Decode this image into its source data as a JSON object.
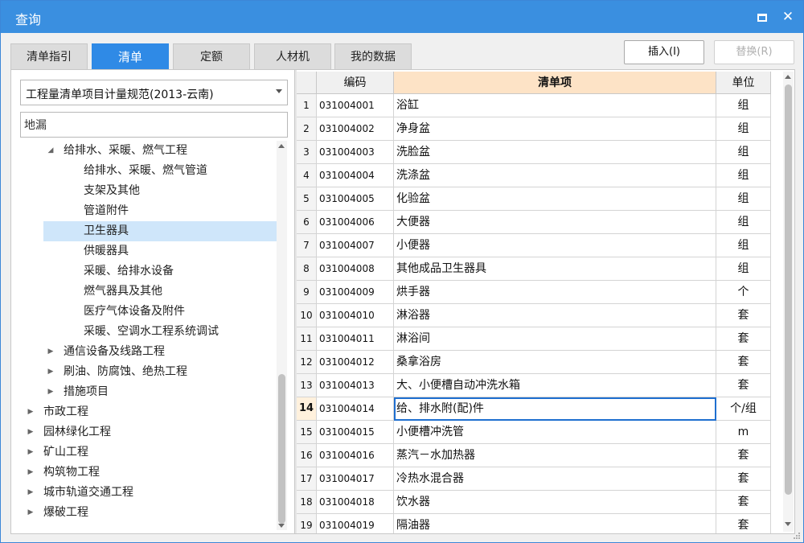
{
  "window": {
    "title": "查询",
    "maximize_icon": "maximize-icon",
    "close_icon": "close-icon",
    "close_glyph": "✕"
  },
  "tabs": [
    {
      "label": "清单指引",
      "active": false
    },
    {
      "label": "清单",
      "active": true
    },
    {
      "label": "定额",
      "active": false
    },
    {
      "label": "人材机",
      "active": false
    },
    {
      "label": "我的数据",
      "active": false
    }
  ],
  "actions": {
    "insert_label": "插入(I)",
    "replace_label": "替换(R)"
  },
  "left": {
    "spec_select": "工程量清单项目计量规范(2013-云南)",
    "filter_value": "地漏",
    "tree": [
      {
        "label": "给排水、采暖、燃气工程",
        "arrow": "◢",
        "level": 2,
        "selected": false
      },
      {
        "label": "给排水、采暖、燃气管道",
        "arrow": "",
        "level": 3,
        "selected": false
      },
      {
        "label": "支架及其他",
        "arrow": "",
        "level": 3,
        "selected": false
      },
      {
        "label": "管道附件",
        "arrow": "",
        "level": 3,
        "selected": false
      },
      {
        "label": "卫生器具",
        "arrow": "",
        "level": 3,
        "selected": true
      },
      {
        "label": "供暖器具",
        "arrow": "",
        "level": 3,
        "selected": false
      },
      {
        "label": "采暖、给排水设备",
        "arrow": "",
        "level": 3,
        "selected": false
      },
      {
        "label": "燃气器具及其他",
        "arrow": "",
        "level": 3,
        "selected": false
      },
      {
        "label": "医疗气体设备及附件",
        "arrow": "",
        "level": 3,
        "selected": false
      },
      {
        "label": "采暖、空调水工程系统调试",
        "arrow": "",
        "level": 3,
        "selected": false
      },
      {
        "label": "通信设备及线路工程",
        "arrow": "▶",
        "level": 2,
        "selected": false
      },
      {
        "label": "刷油、防腐蚀、绝热工程",
        "arrow": "▶",
        "level": 2,
        "selected": false
      },
      {
        "label": "措施项目",
        "arrow": "▶",
        "level": 2,
        "selected": false
      },
      {
        "label": "市政工程",
        "arrow": "▶",
        "level": 1,
        "selected": false
      },
      {
        "label": "园林绿化工程",
        "arrow": "▶",
        "level": 1,
        "selected": false
      },
      {
        "label": "矿山工程",
        "arrow": "▶",
        "level": 1,
        "selected": false
      },
      {
        "label": "构筑物工程",
        "arrow": "▶",
        "level": 1,
        "selected": false
      },
      {
        "label": "城市轨道交通工程",
        "arrow": "▶",
        "level": 1,
        "selected": false
      },
      {
        "label": "爆破工程",
        "arrow": "▶",
        "level": 1,
        "selected": false
      }
    ]
  },
  "grid": {
    "columns": [
      "",
      "编码",
      "清单项",
      "单位"
    ],
    "current_row": 14,
    "rows": [
      {
        "no": "1",
        "code": "031004001",
        "name": "浴缸",
        "unit": "组"
      },
      {
        "no": "2",
        "code": "031004002",
        "name": "净身盆",
        "unit": "组"
      },
      {
        "no": "3",
        "code": "031004003",
        "name": "洗脸盆",
        "unit": "组"
      },
      {
        "no": "4",
        "code": "031004004",
        "name": "洗涤盆",
        "unit": "组"
      },
      {
        "no": "5",
        "code": "031004005",
        "name": "化验盆",
        "unit": "组"
      },
      {
        "no": "6",
        "code": "031004006",
        "name": "大便器",
        "unit": "组"
      },
      {
        "no": "7",
        "code": "031004007",
        "name": "小便器",
        "unit": "组"
      },
      {
        "no": "8",
        "code": "031004008",
        "name": "其他成品卫生器具",
        "unit": "组"
      },
      {
        "no": "9",
        "code": "031004009",
        "name": "烘手器",
        "unit": "个"
      },
      {
        "no": "10",
        "code": "031004010",
        "name": "淋浴器",
        "unit": "套"
      },
      {
        "no": "11",
        "code": "031004011",
        "name": "淋浴间",
        "unit": "套"
      },
      {
        "no": "12",
        "code": "031004012",
        "name": "桑拿浴房",
        "unit": "套"
      },
      {
        "no": "13",
        "code": "031004013",
        "name": "大、小便槽自动冲洗水箱",
        "unit": "套"
      },
      {
        "no": "14",
        "code": "031004014",
        "name": "给、排水附(配)件",
        "unit": "个/组"
      },
      {
        "no": "15",
        "code": "031004015",
        "name": "小便槽冲洗管",
        "unit": "m"
      },
      {
        "no": "16",
        "code": "031004016",
        "name": "蒸汽－水加热器",
        "unit": "套"
      },
      {
        "no": "17",
        "code": "031004017",
        "name": "冷热水混合器",
        "unit": "套"
      },
      {
        "no": "18",
        "code": "031004018",
        "name": "饮水器",
        "unit": "套"
      },
      {
        "no": "19",
        "code": "031004019",
        "name": "隔油器",
        "unit": "套"
      }
    ]
  }
}
